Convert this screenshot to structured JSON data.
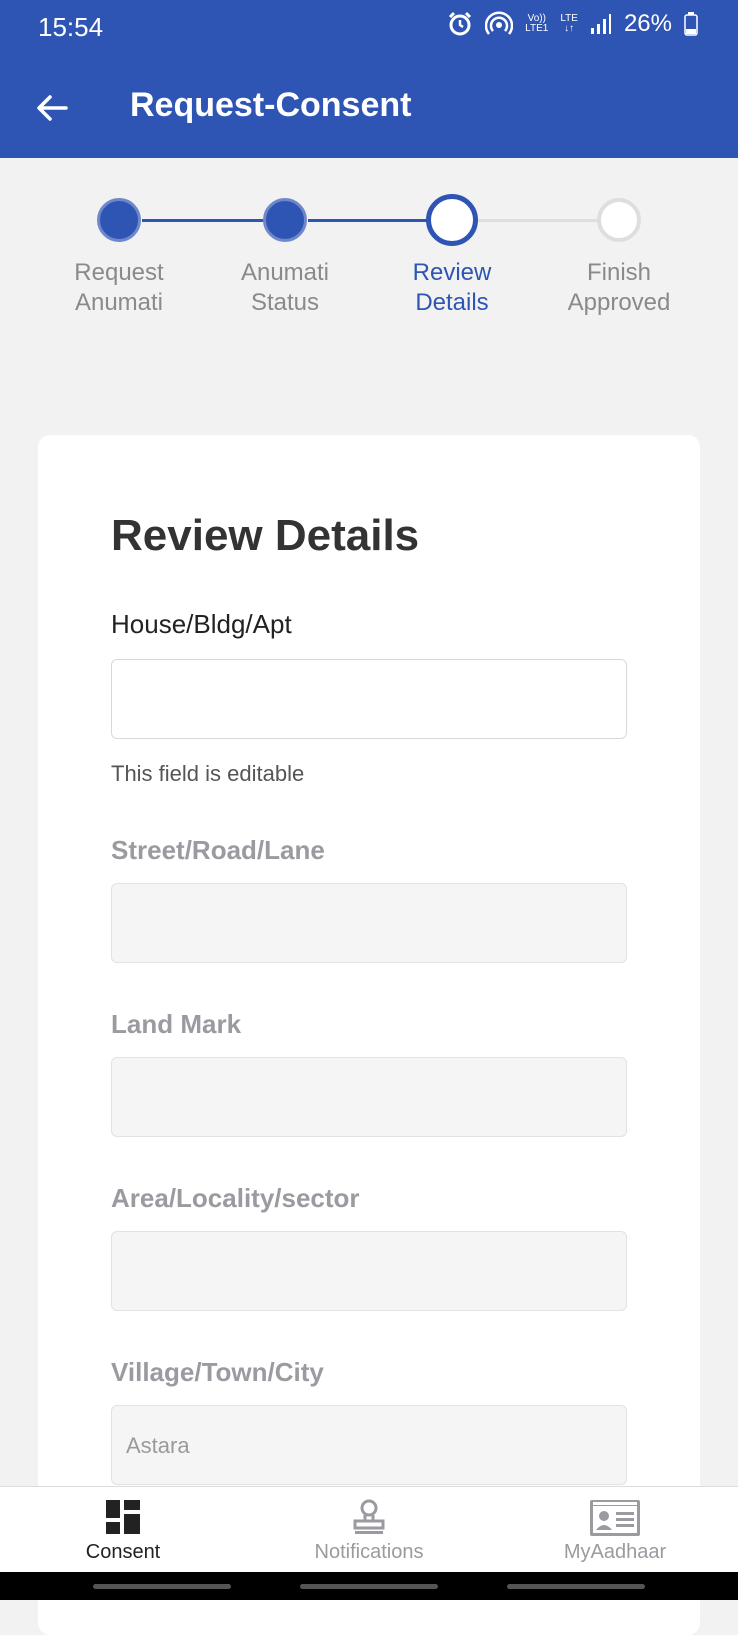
{
  "status_bar": {
    "time": "15:54",
    "network_top": "Vo))",
    "network_bottom": "LTE1",
    "lte_label": "LTE",
    "battery_percent": "26%",
    "battery_level": 0.26
  },
  "header": {
    "title": "Request-Consent"
  },
  "stepper": {
    "steps": [
      {
        "line1": "Request",
        "line2": "Anumati",
        "state": "completed"
      },
      {
        "line1": "Anumati",
        "line2": "Status",
        "state": "completed"
      },
      {
        "line1": "Review",
        "line2": "Details",
        "state": "current"
      },
      {
        "line1": "Finish",
        "line2": "Approved",
        "state": "pending"
      }
    ]
  },
  "form": {
    "title": "Review Details",
    "fields": [
      {
        "label": "House/Bldg/Apt",
        "value": "",
        "editable": true,
        "helper": "This field is editable"
      },
      {
        "label": "Street/Road/Lane",
        "value": "",
        "editable": false
      },
      {
        "label": "Land Mark",
        "value": "",
        "editable": false
      },
      {
        "label": "Area/Locality/sector",
        "value": "",
        "editable": false
      },
      {
        "label": "Village/Town/City",
        "value": "Astara",
        "editable": false
      }
    ]
  },
  "bottom_nav": {
    "items": [
      {
        "label": "Consent",
        "icon": "dashboard-icon",
        "active": true
      },
      {
        "label": "Notifications",
        "icon": "stamp-icon",
        "active": false
      },
      {
        "label": "MyAadhaar",
        "icon": "id-card-icon",
        "active": false
      }
    ]
  },
  "colors": {
    "primary": "#2f55b4",
    "inactive": "#9a9aa0"
  }
}
